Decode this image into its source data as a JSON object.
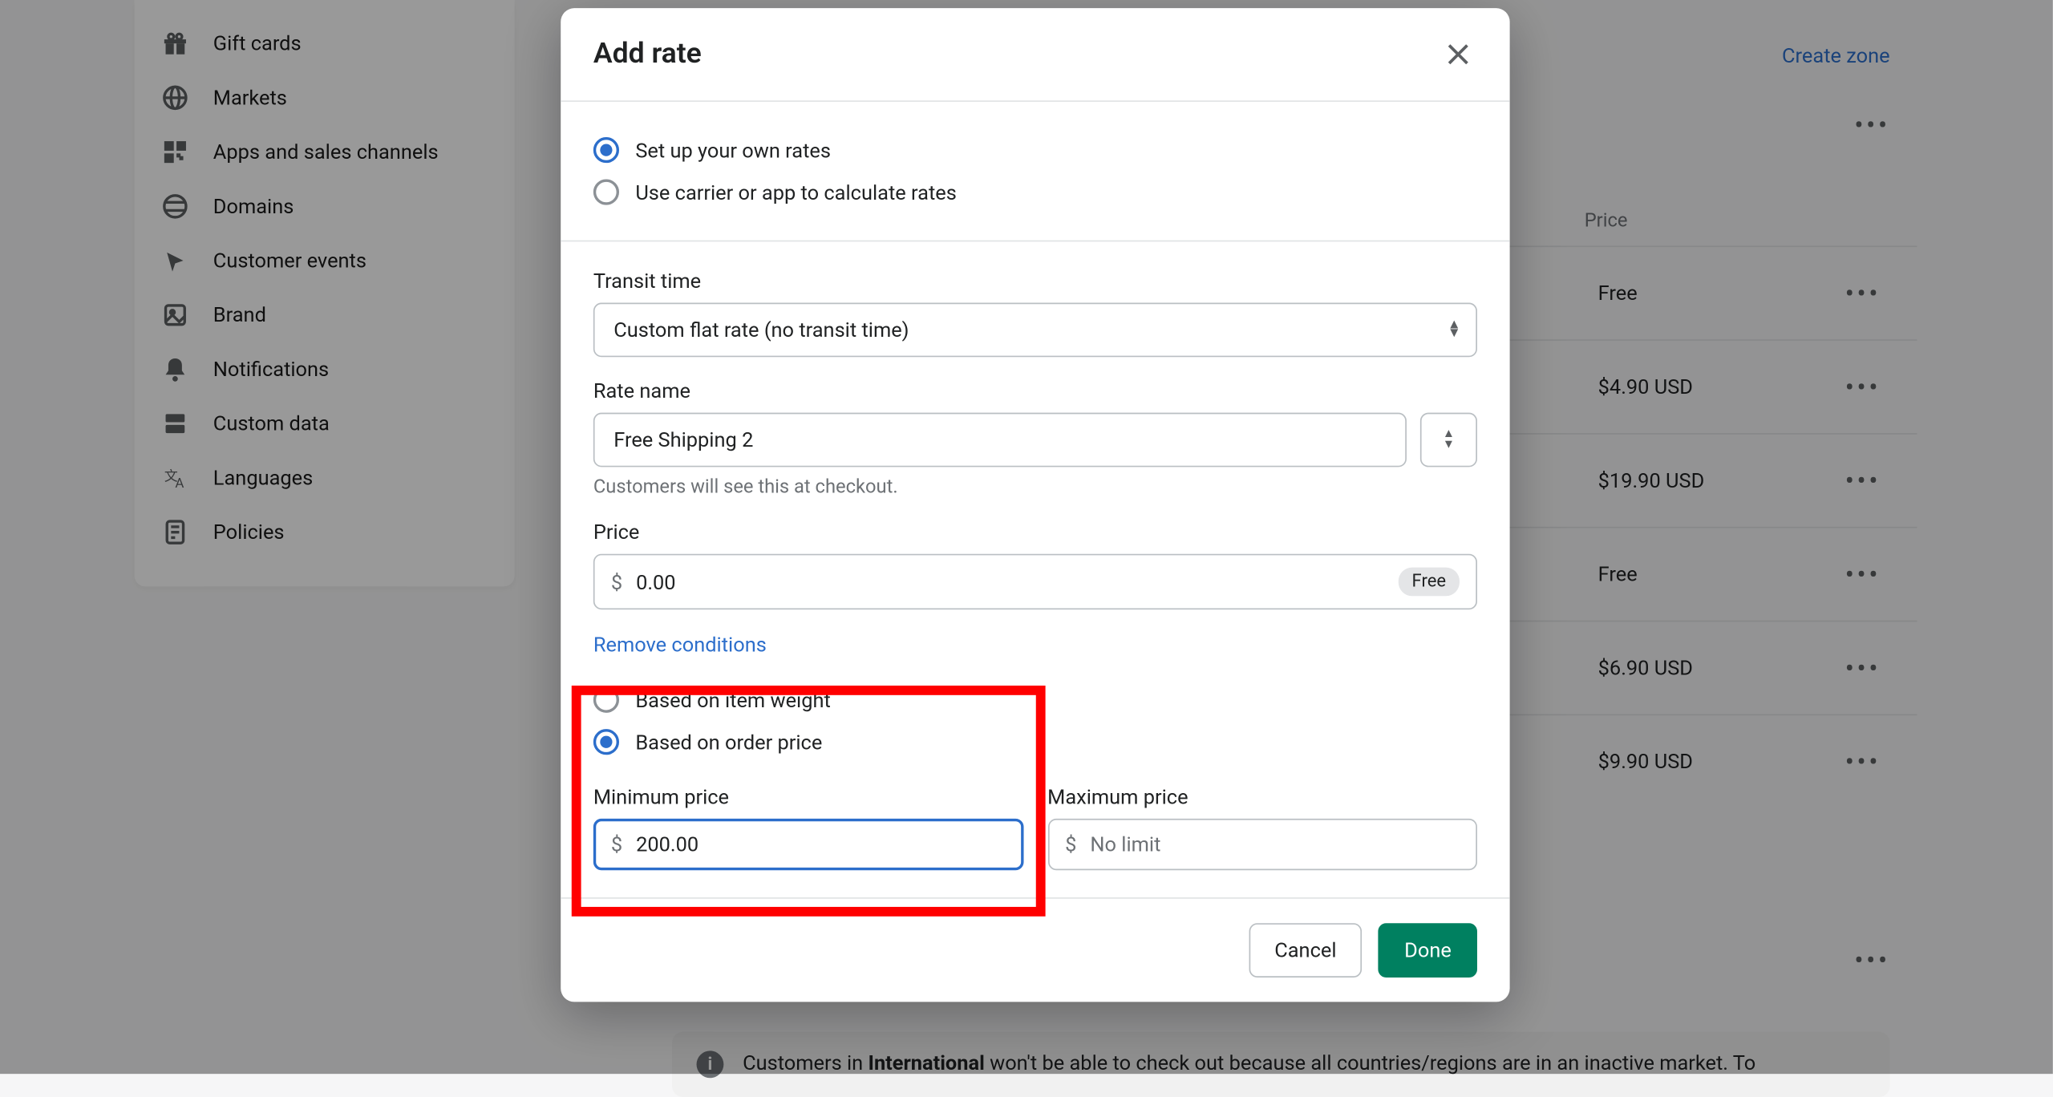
{
  "sidebar": {
    "items": [
      {
        "label": "Gift cards",
        "icon": "gift"
      },
      {
        "label": "Markets",
        "icon": "globe-pin"
      },
      {
        "label": "Apps and sales channels",
        "icon": "apps"
      },
      {
        "label": "Domains",
        "icon": "domain"
      },
      {
        "label": "Customer events",
        "icon": "cursor"
      },
      {
        "label": "Brand",
        "icon": "image"
      },
      {
        "label": "Notifications",
        "icon": "bell"
      },
      {
        "label": "Custom data",
        "icon": "database"
      },
      {
        "label": "Languages",
        "icon": "translate"
      },
      {
        "label": "Policies",
        "icon": "receipt"
      }
    ]
  },
  "topLinks": {
    "createZone": "Create zone"
  },
  "table": {
    "headers": {
      "price": "Price"
    },
    "rows": [
      {
        "price": "Free"
      },
      {
        "price": "$4.90 USD"
      },
      {
        "price": "$19.90 USD"
      },
      {
        "price": "Free"
      },
      {
        "price": "$6.90 USD"
      },
      {
        "price": "$9.90 USD"
      }
    ]
  },
  "banner": {
    "pre": "Customers in ",
    "bold": "International",
    "post": " won't be able to check out because all countries/regions are in an inactive market. To"
  },
  "modal": {
    "title": "Add rate",
    "rateTypeA": "Set up your own rates",
    "rateTypeB": "Use carrier or app to calculate rates",
    "transitLabel": "Transit time",
    "transitValue": "Custom flat rate (no transit time)",
    "rateNameLabel": "Rate name",
    "rateNameValue": "Free Shipping 2",
    "rateNameHelp": "Customers will see this at checkout.",
    "priceLabel": "Price",
    "priceValue": "0.00",
    "freeBadge": "Free",
    "removeConditions": "Remove conditions",
    "condWeight": "Based on item weight",
    "condPrice": "Based on order price",
    "minPriceLabel": "Minimum price",
    "minPriceValue": "200.00",
    "maxPriceLabel": "Maximum price",
    "maxPricePlaceholder": "No limit",
    "cancel": "Cancel",
    "done": "Done",
    "currency": "$"
  }
}
